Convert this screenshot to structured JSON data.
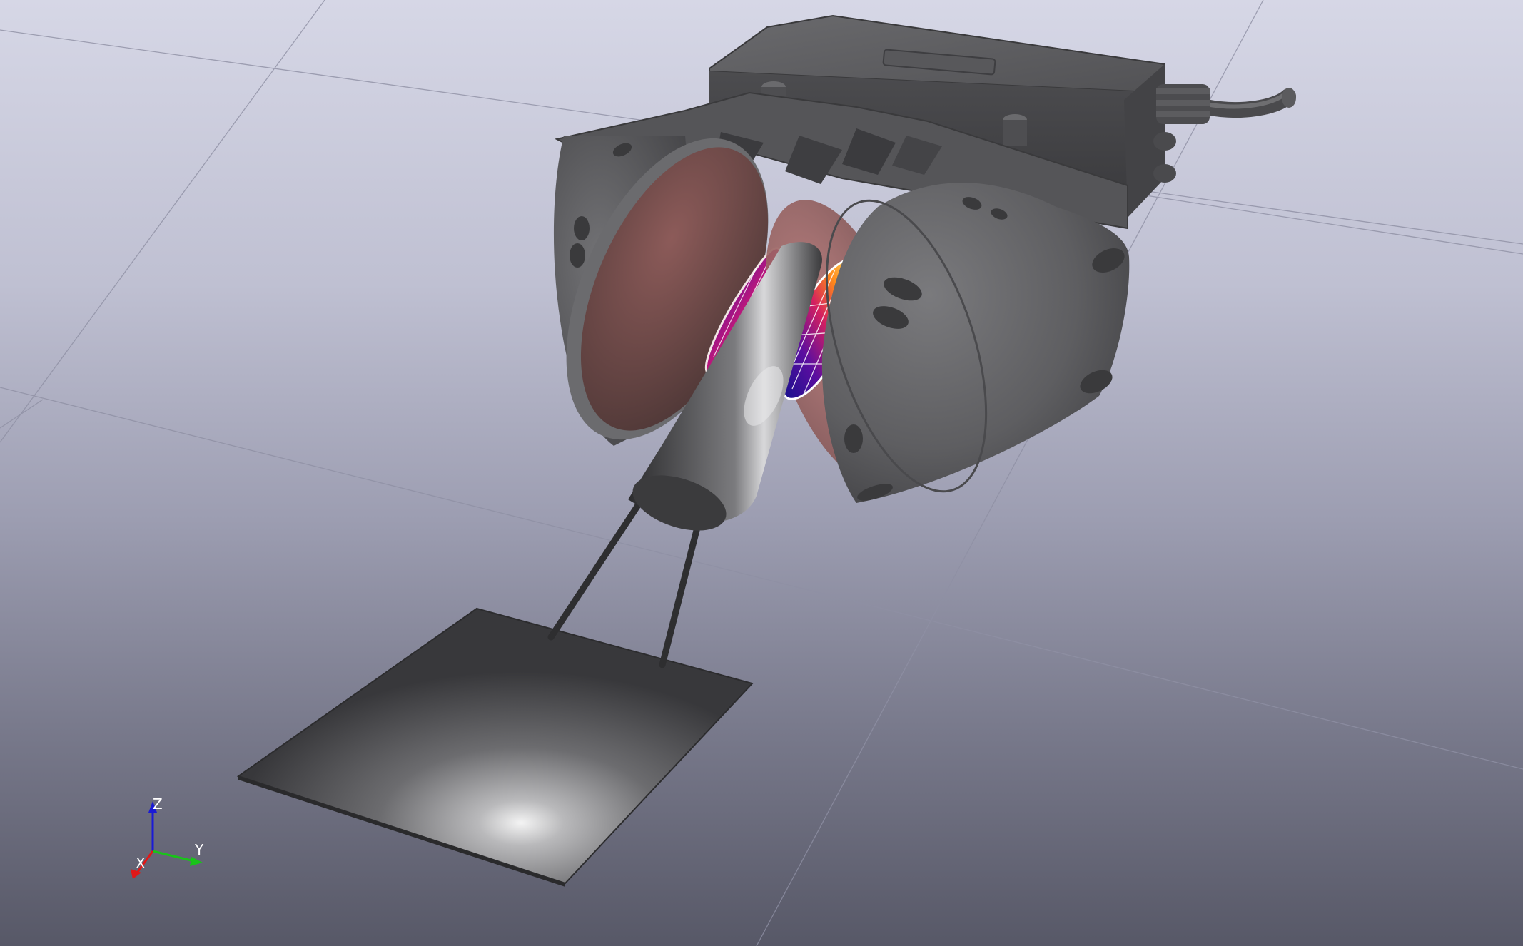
{
  "viewport": {
    "background_top": "#d6d7e6",
    "background_bottom": "#575867"
  },
  "axes": {
    "z_label": "Z",
    "y_label": "Y",
    "x_label": "X",
    "z_color": "#1a1ad6",
    "y_color": "#19c419",
    "x_color": "#e01818"
  },
  "scene": {
    "model_color": "#5e5e61",
    "lens_tint": "#a85c5a",
    "sensor_colormap": [
      "#16128c",
      "#5a0ea0",
      "#c0187a",
      "#f04a26",
      "#ffb020",
      "#fff27a"
    ]
  }
}
